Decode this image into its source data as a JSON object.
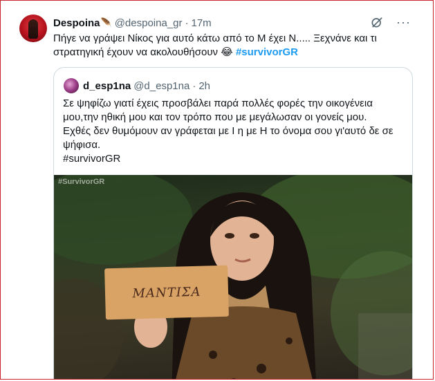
{
  "tweet": {
    "author_name": "Despoina",
    "author_emoji": "🪶",
    "handle": "@despoina_gr",
    "separator": "·",
    "time": "17m",
    "text_line1": "Πήγε να γράψει Νίκος για αυτό κάτω από το Μ έχει Ν..... Ξεχνάνε και τι",
    "text_line2": "στρατηγική έχουν να ακολουθήσουν",
    "emoji": "😂",
    "hashtag": "#survivorGR"
  },
  "quoted_tweet": {
    "author_name": "d_esp1na",
    "handle": "@d_esp1na",
    "separator": "·",
    "time": "2h",
    "text_line1": "Σε ψηφίζω γιατί έχεις προσβάλει παρά πολλές φορές την οικογένεια",
    "text_line2": "μου,την ηθική μου και τον τρόπο που με μεγάλωσαν οι γονείς μου.",
    "text_line3": "Εχθές δεν θυμόμουν αν γράφεται με Ι η με Η το όνομα σου γι'αυτό δε σε",
    "text_line4": "ψήφισα.",
    "hashtag": "#survivorGR",
    "image": {
      "watermark": "#SurvivorGR",
      "sign_text": "ΜΑΝΤΙΣΑ"
    }
  },
  "icons": {
    "grok": "grok-icon",
    "more": "more-icon",
    "more_glyph": "···"
  },
  "colors": {
    "link": "#1d9bf0",
    "muted": "#536471",
    "frame_border": "#c8232c"
  }
}
